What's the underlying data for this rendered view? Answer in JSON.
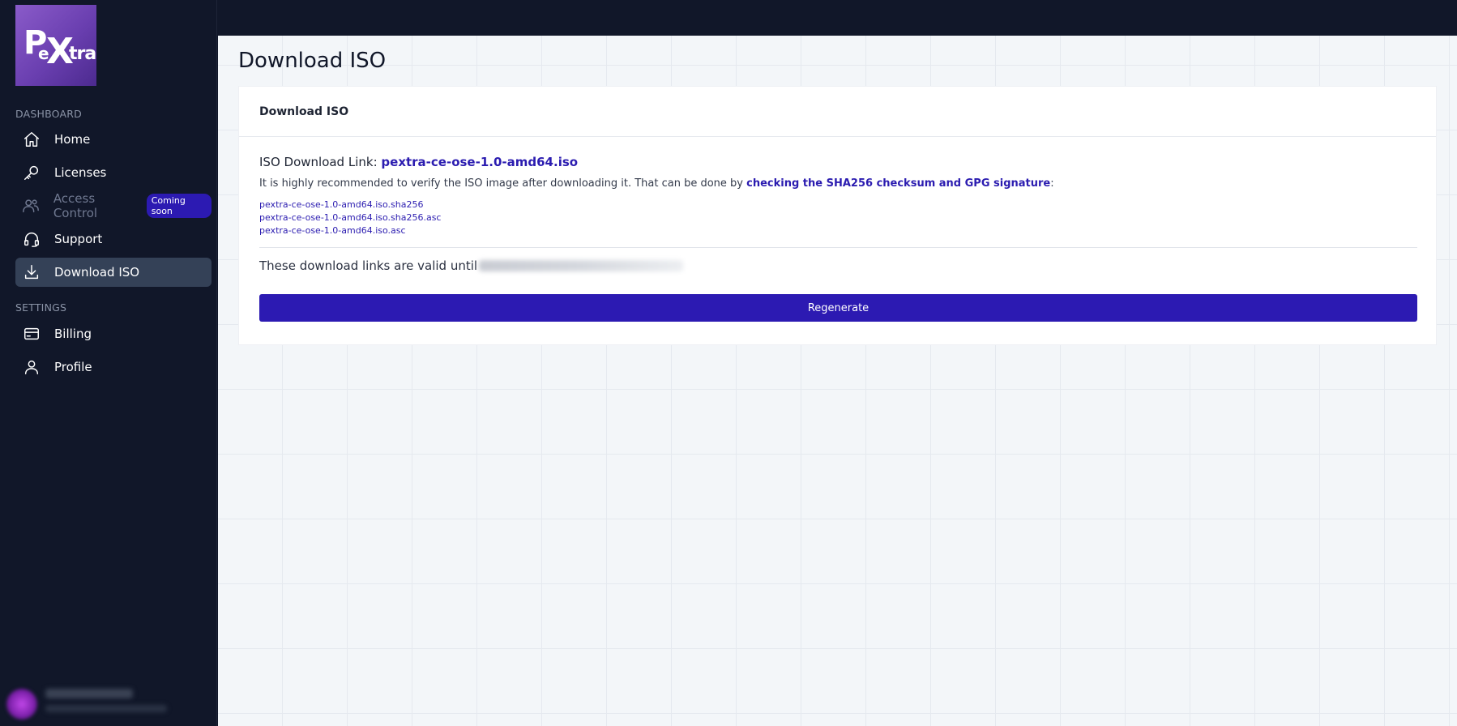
{
  "brand": {
    "logo_text": "PeXtra"
  },
  "sidebar": {
    "sections": [
      {
        "label": "DASHBOARD"
      },
      {
        "label": "SETTINGS"
      }
    ],
    "items": [
      {
        "label": "Home",
        "icon": "home-icon"
      },
      {
        "label": "Licenses",
        "icon": "key-icon"
      },
      {
        "label": "Access Control",
        "icon": "users-icon",
        "badge": "Coming soon"
      },
      {
        "label": "Support",
        "icon": "headset-icon"
      },
      {
        "label": "Download ISO",
        "icon": "download-icon"
      },
      {
        "label": "Billing",
        "icon": "credit-card-icon"
      },
      {
        "label": "Profile",
        "icon": "user-icon"
      }
    ]
  },
  "page": {
    "title": "Download ISO"
  },
  "card": {
    "header": "Download ISO",
    "iso_label": "ISO Download Link:",
    "iso_link": "pextra-ce-ose-1.0-amd64.iso",
    "recommend_text": "It is highly recommended to verify the ISO image after downloading it. That can be done by",
    "recommend_link": "checking the SHA256 checksum and GPG signature",
    "recommend_suffix": ":",
    "files": [
      "pextra-ce-ose-1.0-amd64.iso.sha256",
      "pextra-ce-ose-1.0-amd64.iso.sha256.asc",
      "pextra-ce-ose-1.0-amd64.iso.asc"
    ],
    "valid_text": "These download links are valid until",
    "regenerate_label": "Regenerate"
  },
  "colors": {
    "sidebar_bg": "#111729",
    "accent": "#2c1ab2",
    "active_item_bg": "#344157",
    "main_bg": "#f3f6f9"
  }
}
